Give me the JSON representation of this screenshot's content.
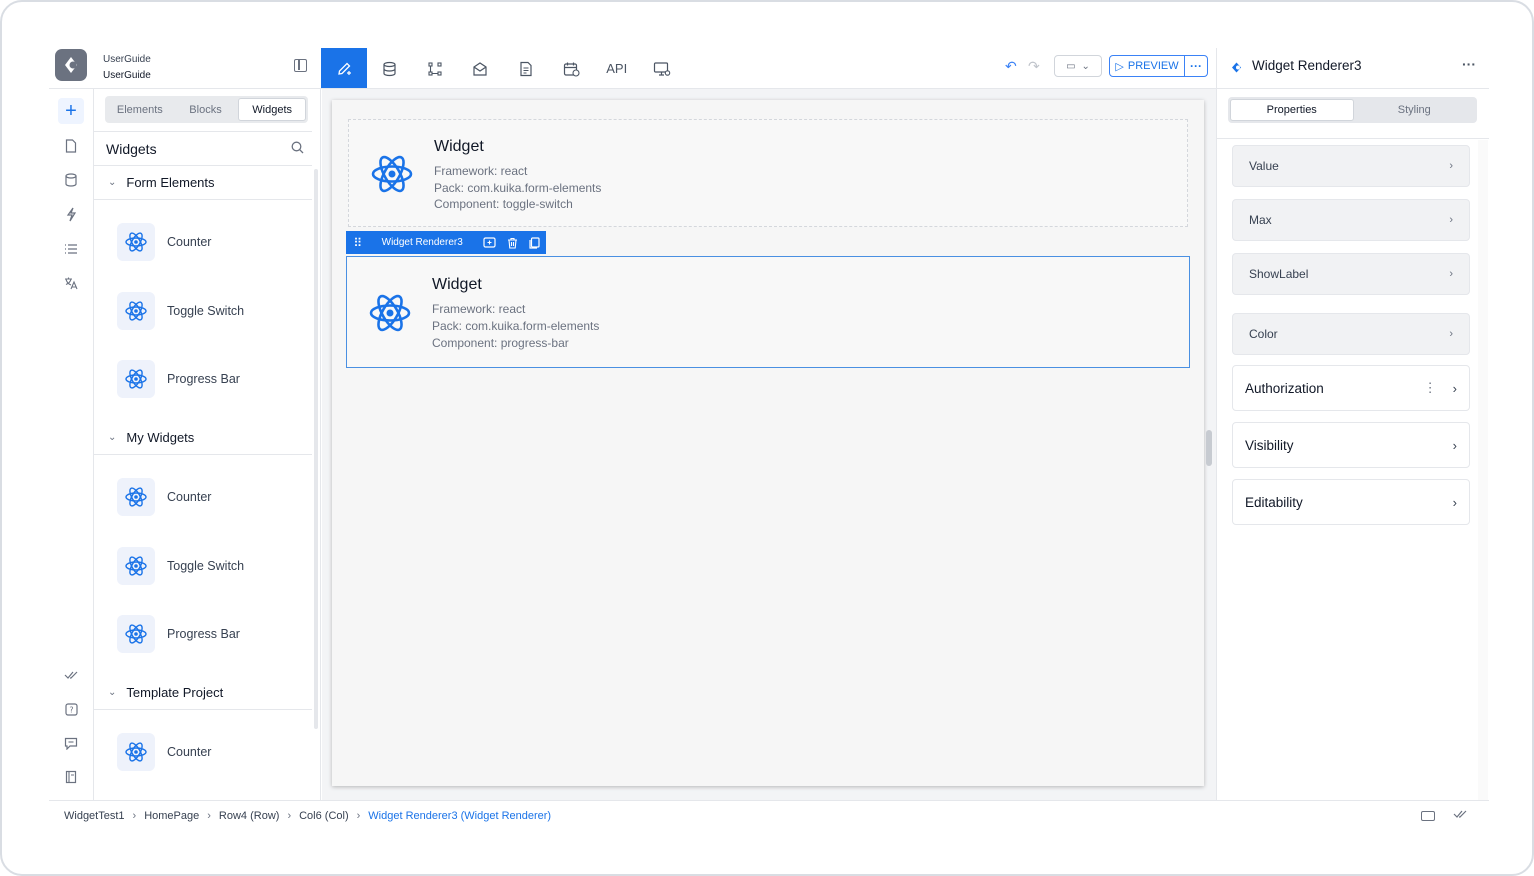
{
  "header": {
    "project_line1": "UserGuide",
    "project_line2": "UserGuide",
    "nav": [
      {
        "icon": "pencil-icon"
      },
      {
        "icon": "database-icon"
      },
      {
        "icon": "workflow-icon"
      },
      {
        "icon": "mail-icon"
      },
      {
        "icon": "document-icon"
      },
      {
        "icon": "calendar-icon"
      },
      {
        "label": "API"
      },
      {
        "icon": "monitor-settings-icon"
      }
    ],
    "preview_label": "PREVIEW",
    "more_label": "···"
  },
  "left_panel": {
    "tabs": [
      "Elements",
      "Blocks",
      "Widgets"
    ],
    "active_tab": "Widgets",
    "title": "Widgets",
    "sections": [
      {
        "title": "Form Elements",
        "items": [
          "Counter",
          "Toggle Switch",
          "Progress Bar"
        ]
      },
      {
        "title": "My Widgets",
        "items": [
          "Counter",
          "Toggle Switch",
          "Progress Bar"
        ]
      },
      {
        "title": "Template Project",
        "items": [
          "Counter"
        ]
      }
    ]
  },
  "canvas": {
    "widgets": [
      {
        "title": "Widget",
        "framework": "Framework: react",
        "pack": "Pack: com.kuika.form-elements",
        "component": "Component: toggle-switch"
      },
      {
        "title": "Widget",
        "framework": "Framework: react",
        "pack": "Pack: com.kuika.form-elements",
        "component": "Component: progress-bar"
      }
    ],
    "selection_label": "Widget Renderer3"
  },
  "right_panel": {
    "title": "Widget Renderer3",
    "tabs": [
      "Properties",
      "Styling"
    ],
    "active_tab": "Properties",
    "properties": [
      "Value",
      "Max",
      "ShowLabel",
      "Color"
    ],
    "sections": [
      "Authorization",
      "Visibility",
      "Editability"
    ]
  },
  "breadcrumb": [
    "WidgetTest1",
    "HomePage",
    "Row4 (Row)",
    "Col6 (Col)",
    "Widget Renderer3 (Widget Renderer)"
  ],
  "colors": {
    "accent": "#1a73e8",
    "react_icon": "#1a73e8"
  }
}
